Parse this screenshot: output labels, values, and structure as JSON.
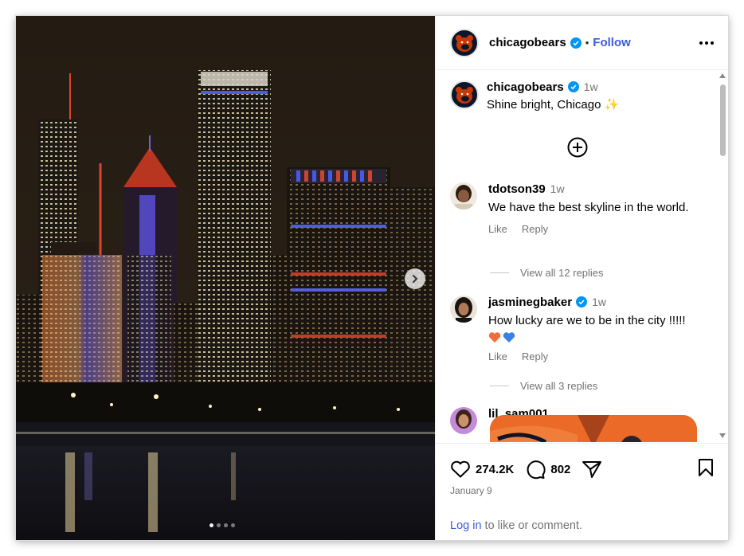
{
  "post": {
    "username": "chicagobears",
    "follow_label": "Follow",
    "separator": "•",
    "caption_age": "1w",
    "caption_text": "Shine bright, Chicago",
    "caption_emoji": "✨"
  },
  "comments": [
    {
      "username": "tdotson39",
      "age": "1w",
      "text": "We have the best skyline in the world.",
      "like": "Like",
      "reply": "Reply",
      "view_replies": "View all 12 replies"
    },
    {
      "username": "jasminegbaker",
      "age": "1w",
      "text": "How lucky are we to be in the city !!!!!",
      "like": "Like",
      "reply": "Reply",
      "view_replies": "View all 3 replies"
    },
    {
      "username": "lil_sam001"
    }
  ],
  "actions": {
    "likes": "274.2K",
    "comments": "802",
    "date": "January 9",
    "login_link": "Log in",
    "login_rest": " to like or comment."
  },
  "media": {
    "slides": 4,
    "active_slide": 1
  },
  "icons": [
    "bears-logo-icon",
    "verified-icon",
    "more-icon",
    "add-circle-icon",
    "heart-icon",
    "comment-icon",
    "share-icon",
    "bookmark-icon",
    "chevron-right-icon"
  ],
  "colors": {
    "link": "#3b5bdb",
    "bears_navy": "#0b162a",
    "bears_orange": "#c83803",
    "muted": "#737373"
  }
}
